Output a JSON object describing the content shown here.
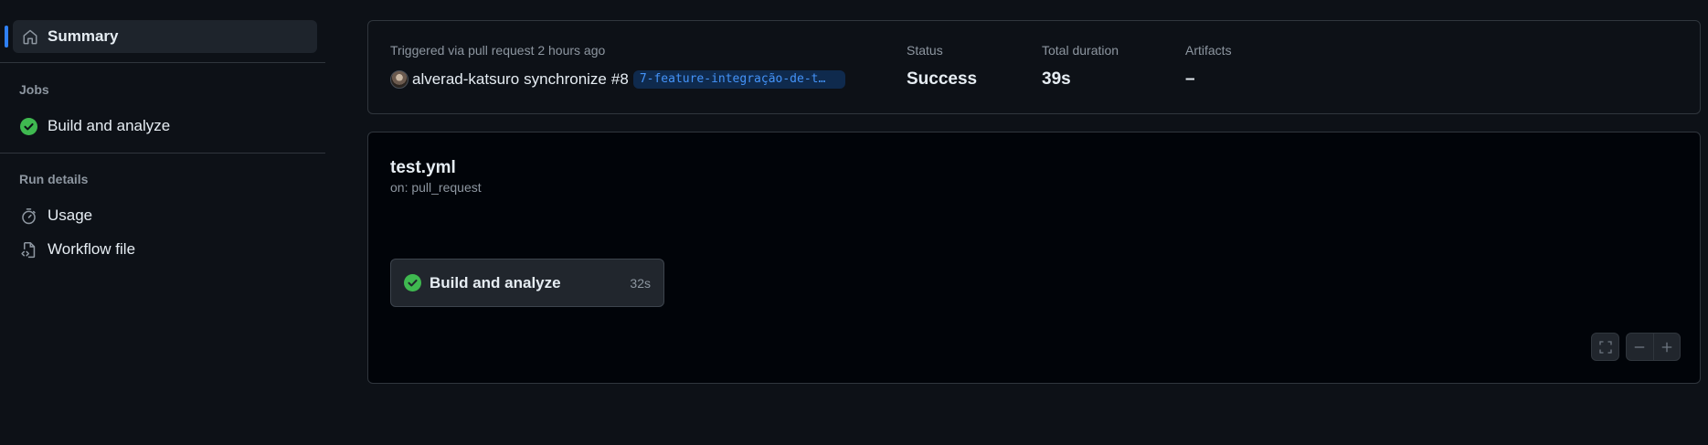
{
  "sidebar": {
    "summary_label": "Summary",
    "jobs_heading": "Jobs",
    "jobs": [
      {
        "label": "Build and analyze",
        "status": "success"
      }
    ],
    "run_details_heading": "Run details",
    "run_details": [
      {
        "label": "Usage",
        "icon": "stopwatch-icon"
      },
      {
        "label": "Workflow file",
        "icon": "file-code-icon"
      }
    ]
  },
  "run_summary": {
    "trigger_text": "Triggered via pull request 2 hours ago",
    "actor": "alverad-katsuro",
    "event": "synchronize",
    "pr_number": "#8",
    "branch": "7-feature-integração-de-t…",
    "stats": {
      "status_label": "Status",
      "status_value": "Success",
      "duration_label": "Total duration",
      "duration_value": "39s",
      "artifacts_label": "Artifacts",
      "artifacts_value": "–"
    }
  },
  "workflow": {
    "name": "test.yml",
    "trigger": "on: pull_request",
    "job": {
      "label": "Build and analyze",
      "duration": "32s",
      "status": "success"
    }
  },
  "colors": {
    "background": "#0d1117",
    "graph_background": "#010409",
    "accent": "#2f81f7",
    "success": "#3fb950",
    "border": "#30363d",
    "muted_text": "#8d96a0",
    "link": "#4493f8"
  }
}
